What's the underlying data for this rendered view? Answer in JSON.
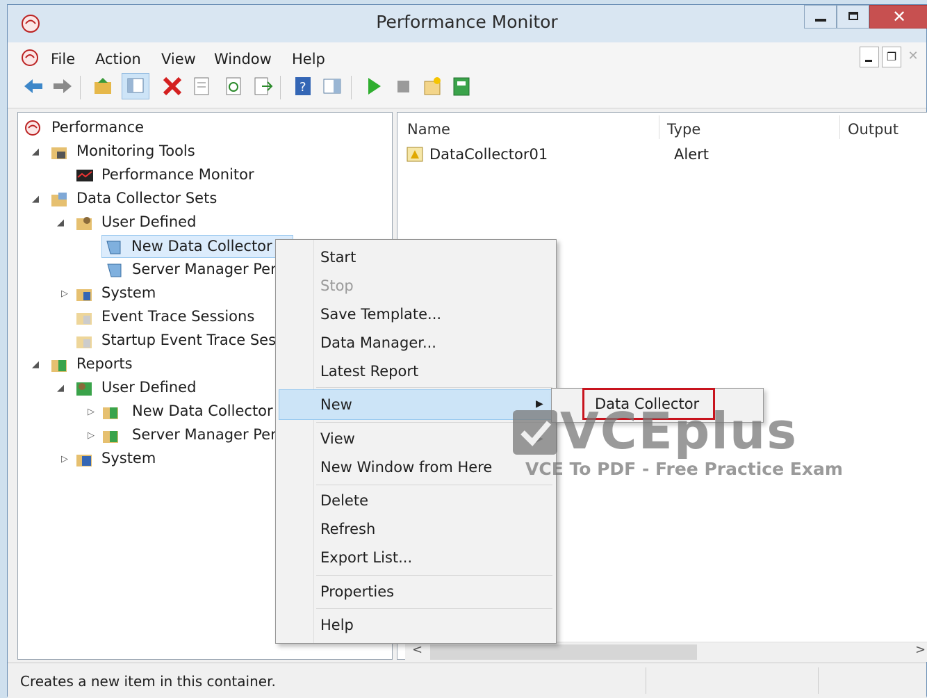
{
  "window": {
    "title": "Performance Monitor"
  },
  "menubar": {
    "items": [
      "File",
      "Action",
      "View",
      "Window",
      "Help"
    ]
  },
  "tree": {
    "items": [
      {
        "label": "Performance",
        "level": 0
      },
      {
        "label": "Monitoring Tools",
        "level": 1
      },
      {
        "label": "Performance Monitor",
        "level": 2
      },
      {
        "label": "Data Collector Sets",
        "level": 1
      },
      {
        "label": "User Defined",
        "level": 2
      },
      {
        "label": "New Data Collector Se",
        "level": 3
      },
      {
        "label": "Server Manager Perfor",
        "level": 3
      },
      {
        "label": "System",
        "level": 2
      },
      {
        "label": "Event Trace Sessions",
        "level": 2
      },
      {
        "label": "Startup Event Trace Sessio",
        "level": 2
      },
      {
        "label": "Reports",
        "level": 1
      },
      {
        "label": "User Defined",
        "level": 2
      },
      {
        "label": "New Data Collector Se",
        "level": 3
      },
      {
        "label": "Server Manager Perfor",
        "level": 3
      },
      {
        "label": "System",
        "level": 2
      }
    ]
  },
  "list": {
    "columns": [
      "Name",
      "Type",
      "Output"
    ],
    "rows": [
      {
        "name": "DataCollector01",
        "type": "Alert",
        "output": ""
      }
    ]
  },
  "context_menu": {
    "items": [
      "Start",
      "Stop",
      "Save Template...",
      "Data Manager...",
      "Latest Report",
      "New",
      "View",
      "New Window from Here",
      "Delete",
      "Refresh",
      "Export List...",
      "Properties",
      "Help"
    ],
    "disabled": [
      "Stop"
    ],
    "highlighted": "New"
  },
  "submenu": {
    "items": [
      "Data Collector"
    ]
  },
  "status": {
    "text": "Creates a new item in this container."
  },
  "watermark": {
    "brand": "VCEplus",
    "tagline": "VCE To PDF - Free Practice Exam"
  },
  "colors": {
    "accent": "#cce4f7",
    "highlight_box": "#c8141e",
    "titlebar": "#d9e6f2"
  }
}
